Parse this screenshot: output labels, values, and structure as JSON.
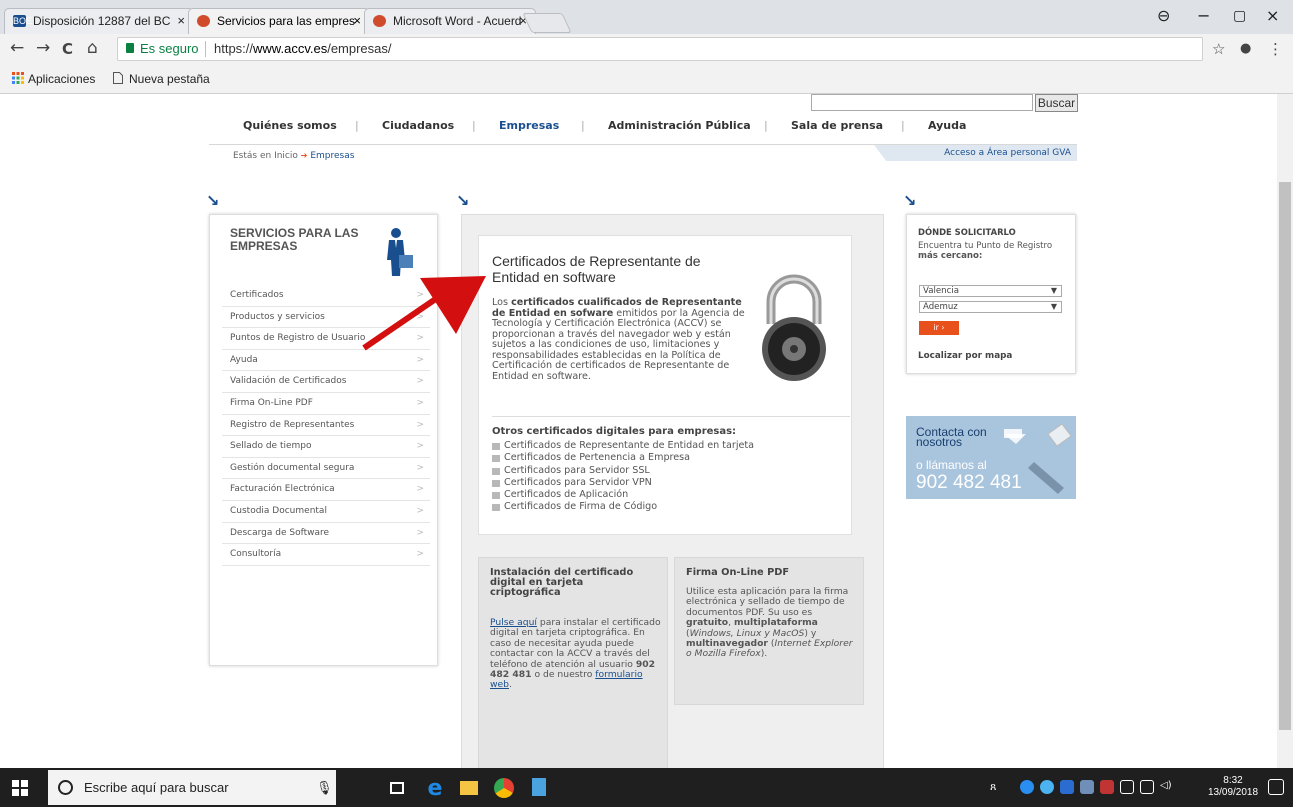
{
  "browser": {
    "tabs": [
      {
        "label": "Disposición 12887 del BC",
        "fav_text": "BOE",
        "fav_color": "#1a4f8f"
      },
      {
        "label": "Servicios para las empres",
        "fav_text": "",
        "fav_color": "#d04a2c"
      },
      {
        "label": "Microsoft Word - Acuerd",
        "fav_text": "",
        "fav_color": "#d04a2c"
      }
    ],
    "tab_close": "×",
    "back": "←",
    "forward": "→",
    "reload": "C",
    "home": "⌂",
    "secure_label": "Es seguro",
    "url_prefix": "https://",
    "url_host": "www.accv.es",
    "url_path": "/empresas/",
    "star": "☆",
    "ext": "●",
    "menu": "⋮",
    "win_profile": "⊖",
    "win_min": "−",
    "win_max": "▢",
    "win_close": "×",
    "bookmarks": [
      {
        "label": "Aplicaciones",
        "icon": "apps-grid-icon"
      },
      {
        "label": "Nueva pestaña",
        "icon": "page-icon"
      }
    ]
  },
  "site": {
    "search_button": "Buscar",
    "nav": [
      "Quiénes somos",
      "Ciudadanos",
      "Empresas",
      "Administración Pública",
      "Sala de prensa",
      "Ayuda"
    ],
    "nav_active_index": 2,
    "crumb_prefix": "Estás en Inicio",
    "crumb_arrow": "➔",
    "crumb_current": "Empresas",
    "gva_link": "Acceso a Área personal GVA",
    "arrow_marker": "↘",
    "left": {
      "title_lines": [
        "SERVICIOS PARA LAS",
        "EMPRESAS"
      ],
      "menu": [
        "Certificados",
        "Productos y servicios",
        "Puntos de Registro de Usuario",
        "Ayuda",
        "Validación de Certificados",
        "Firma On-Line PDF",
        "Registro de Representantes",
        "Sellado de tiempo",
        "Gestión documental segura",
        "Facturación Electrónica",
        "Custodia Documental",
        "Descarga de Software",
        "Consultoría"
      ],
      "chevron": ">"
    },
    "main": {
      "title_lines": [
        "Certificados de Representante de",
        "Entidad en software"
      ],
      "para_lead": "Los ",
      "para_bold": "certificados cualificados de Representante de Entidad en sofware",
      "para_rest": " emitidos por la Agencia de Tecnología y Certificación Electrónica (ACCV) se proporcionan a través del navegador web y están sujetos a las condiciones de uso, limitaciones y responsabilidades establecidas en la Política de Certificación de certificados de Representante de Entidad en software.",
      "other_heading": "Otros certificados digitales para empresas:",
      "other_list": [
        "Certificados de Representante de Entidad en tarjeta",
        "Certificados de Pertenencia a Empresa",
        "Certificados para Servidor SSL",
        "Certificados para Servidor VPN",
        "Certificados de Aplicación",
        "Certificados de Firma de Código"
      ]
    },
    "card1": {
      "title_lines": [
        "Instalación del certificado",
        "digital en tarjeta",
        "criptográfica"
      ],
      "link1": "Pulse aquí",
      "t1": " para instalar el certificado digital en tarjeta criptográfica. En caso de necesitar ayuda puede contactar con la ACCV a través del teléfono de atención al usuario ",
      "phone": "902 482 481",
      "t2": " o de nuestro ",
      "link2": "formulario web",
      "t3": "."
    },
    "card2": {
      "title": "Firma On-Line PDF",
      "t1": "Utilice esta aplicación para la firma electrónica y sellado de tiempo de documentos PDF. Su uso es ",
      "b1": "gratuito",
      "t2": ", ",
      "b2": "multiplataforma",
      "t3": " (",
      "i1": "Windows, Linux y MacOS",
      "t4": ") y ",
      "b3": "multinavegador",
      "t5": " (",
      "i2": "Internet Explorer o Mozilla Firefox",
      "t6": ")."
    },
    "right": {
      "title": "DÓNDE SOLICITARLO",
      "sub": "Encuentra tu Punto de Registro",
      "sub_bold": "más cercano:",
      "select1": "Valencia",
      "select2": "Ademuz",
      "dropdown_arrow": "▼",
      "go_button": "ir  ›",
      "map_link": "Localizar por mapa"
    },
    "contact": {
      "line1": [
        "Contacta con",
        "nosotros"
      ],
      "line2": "o llámanos al",
      "phone": "902 482 481"
    }
  },
  "taskbar": {
    "search_placeholder": "Escribe aquí para buscar",
    "mic": "🎙",
    "time": "8:32",
    "date": "13/09/2018",
    "colors": {
      "start": "#ffffff",
      "edge": "#1e88e5",
      "explorer": "#f4c542",
      "chrome": "#e44133",
      "notepad": "#4aa3df"
    }
  },
  "colors": {
    "accent": "#1a4f8f",
    "secure": "#0b8043",
    "red_arrow": "#d40f0f",
    "button_orange": "#e8501c"
  }
}
